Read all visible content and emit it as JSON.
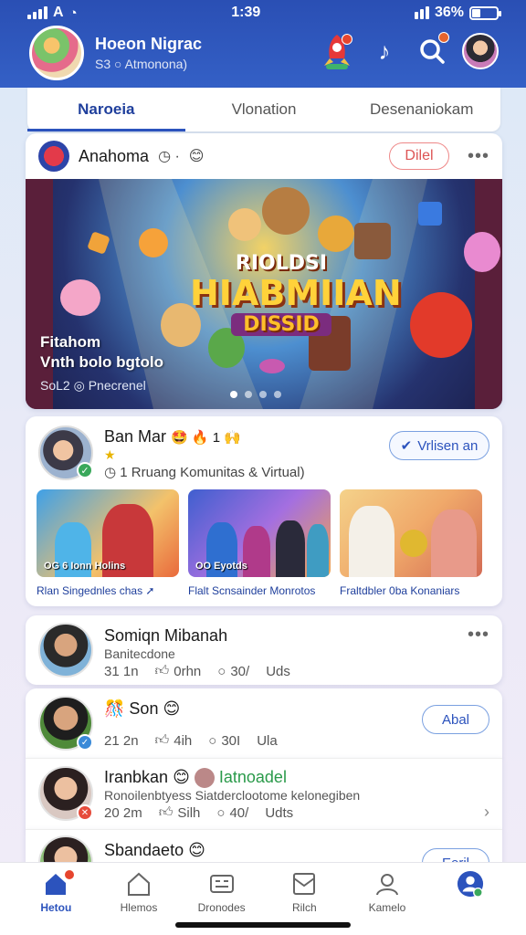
{
  "status_bar": {
    "carrier": "A",
    "time": "1:39",
    "battery_pct": "36%"
  },
  "header": {
    "profile_name": "Hoeon Nigrac",
    "profile_sub": "S3 ○ Atmonona)",
    "icons": [
      "rocket-icon",
      "music-note-icon",
      "search-icon",
      "user-avatar"
    ]
  },
  "tabs": [
    {
      "label": "Naroeia",
      "active": true
    },
    {
      "label": "Vlonation",
      "active": false
    },
    {
      "label": "Desenaniokam",
      "active": false
    }
  ],
  "featured": {
    "name": "Anahoma",
    "follow_label": "Dilel",
    "banner_title_1": "RIOLDSI",
    "banner_title_2": "HIABMIIAN",
    "banner_title_3": "DISSID",
    "caption_1": "Fitahom",
    "caption_2": "Vnth bolo bgtolo",
    "meta": "SoL2 ◎ Pnecrenel",
    "dots_total": 4,
    "dots_active": 1
  },
  "community": {
    "name": "Ban Mar",
    "emojis": "🤩 🔥 1 🙌",
    "subtitle": "1 Rruang Komunitas & Virtual)",
    "follow_label": "Vrlisen an",
    "thumbs": [
      {
        "label": "OG 6 Ionn Holins",
        "caption": "Rlan Singednles chas"
      },
      {
        "label": "OO Eyotds",
        "caption": "Flalt Scnsainder Monrotos"
      },
      {
        "label": "",
        "caption": "Fraltdbler 0ba Konaniars"
      }
    ]
  },
  "posts": [
    {
      "name": "Somiqn Mibanah",
      "sub": "Banitecdone",
      "time": "31 1n",
      "likes": "0rhn",
      "comments": "30/",
      "shares": "Uds",
      "button": ""
    },
    {
      "name": "Son",
      "sub": "",
      "time": "21 2n",
      "likes": "4ih",
      "comments": "30I",
      "shares": "Ula",
      "button": "Abal"
    },
    {
      "name": "Iranbkan",
      "tag": "Iatnoadel",
      "sub": "Ronoilenbtyess Siatderclootome kelonegiben",
      "time": "20 2m",
      "likes": "Silh",
      "comments": "40/",
      "shares": "Udts",
      "button": ""
    },
    {
      "name": "Sbandaeto",
      "sub": "",
      "button": "Eeril"
    }
  ],
  "bottom_nav": [
    {
      "label": "Hetou",
      "icon": "home-icon",
      "active": true
    },
    {
      "label": "Hlemos",
      "icon": "house-outline-icon",
      "active": false
    },
    {
      "label": "Dronodes",
      "icon": "card-icon",
      "active": false
    },
    {
      "label": "Rilch",
      "icon": "inbox-icon",
      "active": false
    },
    {
      "label": "Kamelo",
      "icon": "person-icon",
      "active": false
    },
    {
      "label": "",
      "icon": "profile-icon",
      "active": false
    }
  ],
  "colors": {
    "brand": "#2c53bd",
    "header": "#2a4fb4",
    "alert": "#e6452e"
  }
}
